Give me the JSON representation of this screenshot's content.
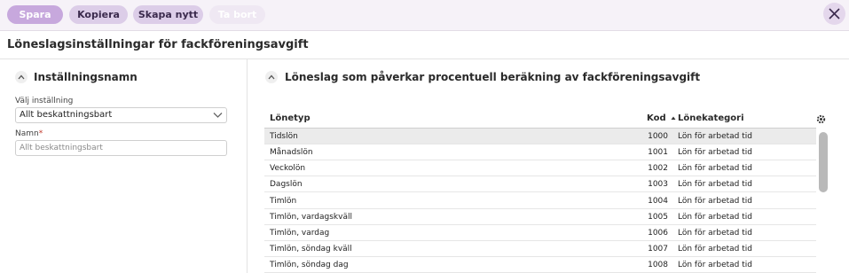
{
  "toolbar": {
    "buttons": [
      {
        "label": "Spara"
      },
      {
        "label": "Kopiera"
      },
      {
        "label": "Skapa nytt"
      },
      {
        "label": "Ta bort"
      }
    ]
  },
  "page": {
    "title": "Löneslagsinställningar för fackföreningsavgift"
  },
  "left": {
    "section_title": "Inställningsnamn",
    "select_label": "Välj inställning",
    "select_value": "Allt beskattningsbart",
    "name_label": "Namn",
    "name_placeholder": "Allt beskattningsbart"
  },
  "right": {
    "section_title": "Löneslag som påverkar procentuell beräkning av fackföreningsavgift",
    "columns": {
      "lonetyp": "Lönetyp",
      "kod": "Kod",
      "lonekategori": "Lönekategori"
    },
    "rows": [
      {
        "lonetyp": "Tidslön",
        "kod": "1000",
        "kategori": "Lön för arbetad tid"
      },
      {
        "lonetyp": "Månadslön",
        "kod": "1001",
        "kategori": "Lön för arbetad tid"
      },
      {
        "lonetyp": "Veckolön",
        "kod": "1002",
        "kategori": "Lön för arbetad tid"
      },
      {
        "lonetyp": "Dagslön",
        "kod": "1003",
        "kategori": "Lön för arbetad tid"
      },
      {
        "lonetyp": "Timlön",
        "kod": "1004",
        "kategori": "Lön för arbetad tid"
      },
      {
        "lonetyp": "Timlön, vardagskväll",
        "kod": "1005",
        "kategori": "Lön för arbetad tid"
      },
      {
        "lonetyp": "Timlön, vardag",
        "kod": "1006",
        "kategori": "Lön för arbetad tid"
      },
      {
        "lonetyp": "Timlön, söndag kväll",
        "kod": "1007",
        "kategori": "Lön för arbetad tid"
      },
      {
        "lonetyp": "Timlön, söndag dag",
        "kod": "1008",
        "kategori": "Lön för arbetad tid"
      }
    ]
  },
  "icons": {
    "close": "close-icon",
    "collapse": "chevron-up-icon",
    "sort": "sort-up-icon",
    "settings": "gear-icon",
    "dropdown": "chevron-down-icon"
  },
  "colors": {
    "accent": "#c7a8dd",
    "toolbar_bg": "#f6f2f8",
    "required": "#c0392b"
  }
}
